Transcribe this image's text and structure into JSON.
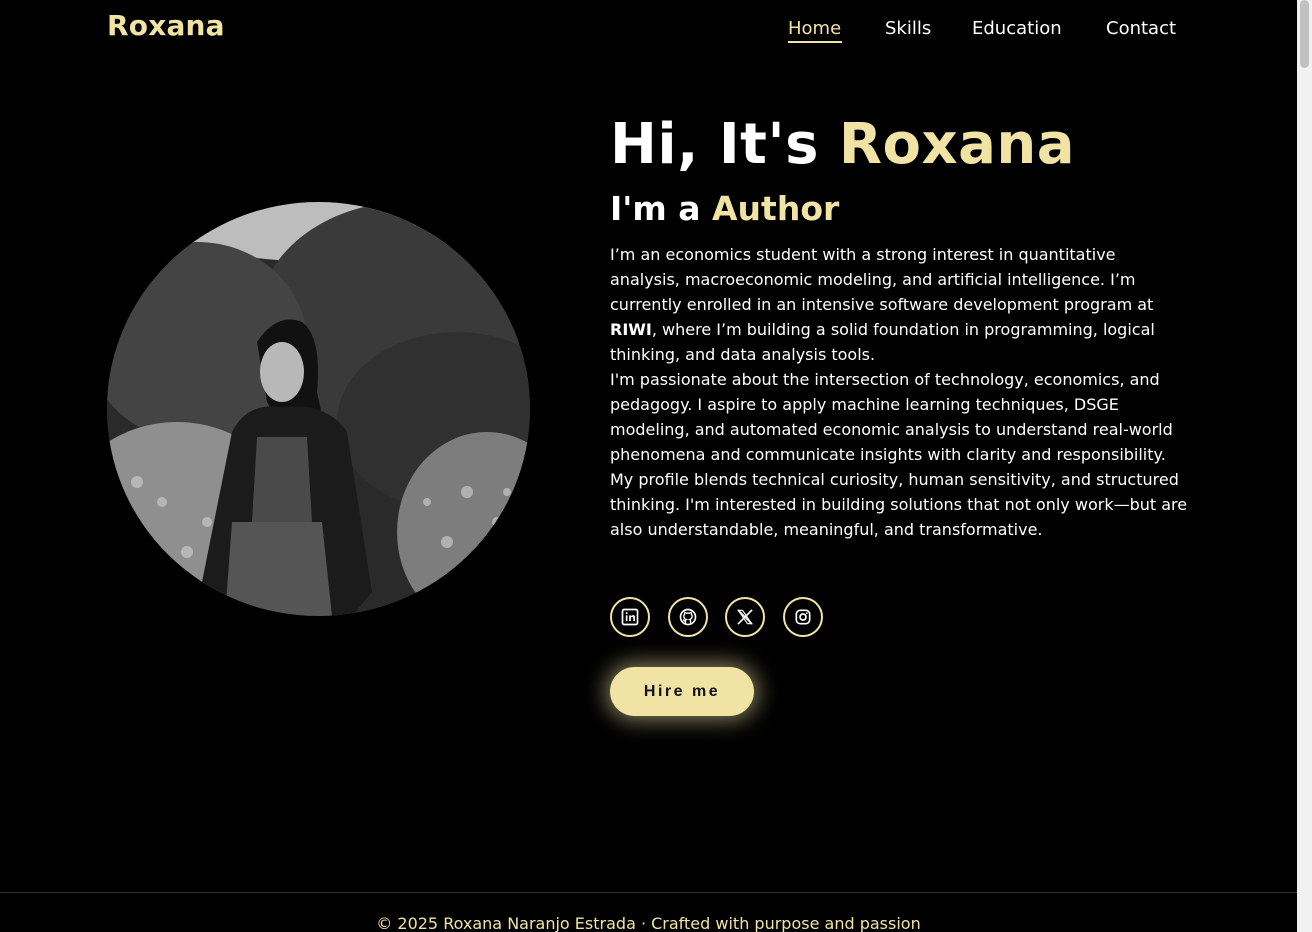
{
  "header": {
    "logo": "Roxana",
    "nav": [
      {
        "label": "Home",
        "active": true
      },
      {
        "label": "Skills",
        "active": false
      },
      {
        "label": "Education",
        "active": false
      },
      {
        "label": "Contact",
        "active": false
      }
    ]
  },
  "hero": {
    "title_prefix": "Hi, It's ",
    "title_name": "Roxana",
    "subtitle_prefix": "I'm a ",
    "subtitle_role": "Author",
    "bio": {
      "p1_before": "I’m an economics student with a strong interest in quantitative analysis, macroeconomic modeling, and artificial intelligence. I’m currently enrolled in an intensive software development program at ",
      "p1_bold": "RIWI",
      "p1_after": ", where I’m building a solid foundation in programming, logical thinking, and data analysis tools.",
      "p2": "I'm passionate about the intersection of technology, economics, and pedagogy. I aspire to apply machine learning techniques, DSGE modeling, and automated economic analysis to understand real-world phenomena and communicate insights with clarity and responsibility.",
      "p3": "My profile blends technical curiosity, human sensitivity, and structured thinking. I'm interested in building solutions that not only work—but are also understandable, meaningful, and transformative."
    },
    "socials": [
      {
        "icon": "linkedin-icon"
      },
      {
        "icon": "github-icon"
      },
      {
        "icon": "x-icon"
      },
      {
        "icon": "instagram-icon"
      }
    ],
    "hire_button": "Hire me",
    "photo_icon": "profile-photo"
  },
  "footer": {
    "text": "© 2025 Roxana Naranjo Estrada · Crafted with purpose and passion"
  },
  "colors": {
    "accent": "#f0e3a4",
    "background": "#000000",
    "text": "#ffffff"
  }
}
